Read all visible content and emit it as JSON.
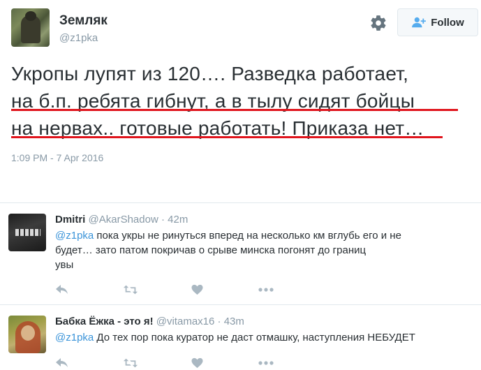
{
  "main_tweet": {
    "display_name": "Земляк",
    "screen_name": "@z1pka",
    "follow_label": "Follow",
    "text_lines": [
      "Укропы лупят из 120…. Разведка работает,",
      "на б.п. ребята гибнут, а в тылу сидят бойцы",
      "на нервах.. готовые работать!  Приказа нет…"
    ],
    "timestamp": "1:09 PM - 7 Apr 2016"
  },
  "replies": [
    {
      "name": "Dmitri",
      "handle": "@AkarShadow",
      "sep": " · ",
      "time": "42m",
      "mention": "@z1pka",
      "text_line1": " пока укры не ринуться вперед  на несколько км вглубь его и не",
      "text_line2": "будет… зато патом покричав о срыве минска погонят до границ",
      "text_line3": "увы"
    },
    {
      "name": "Бабка Ёжка - это я!",
      "handle": "@vitamax16",
      "sep": " · ",
      "time": "43m",
      "mention": "@z1pka",
      "text_line1": " До тех пор пока куратор не даст отмашку, наступления НЕБУДЕТ"
    }
  ],
  "icons": [
    "gear-icon",
    "follow-user-icon",
    "reply-icon",
    "retweet-icon",
    "like-icon",
    "more-icon"
  ],
  "colors": {
    "underline": "#e0141c",
    "link": "#3b94d9",
    "muted": "#8899a6",
    "icon": "#aab8c2"
  }
}
